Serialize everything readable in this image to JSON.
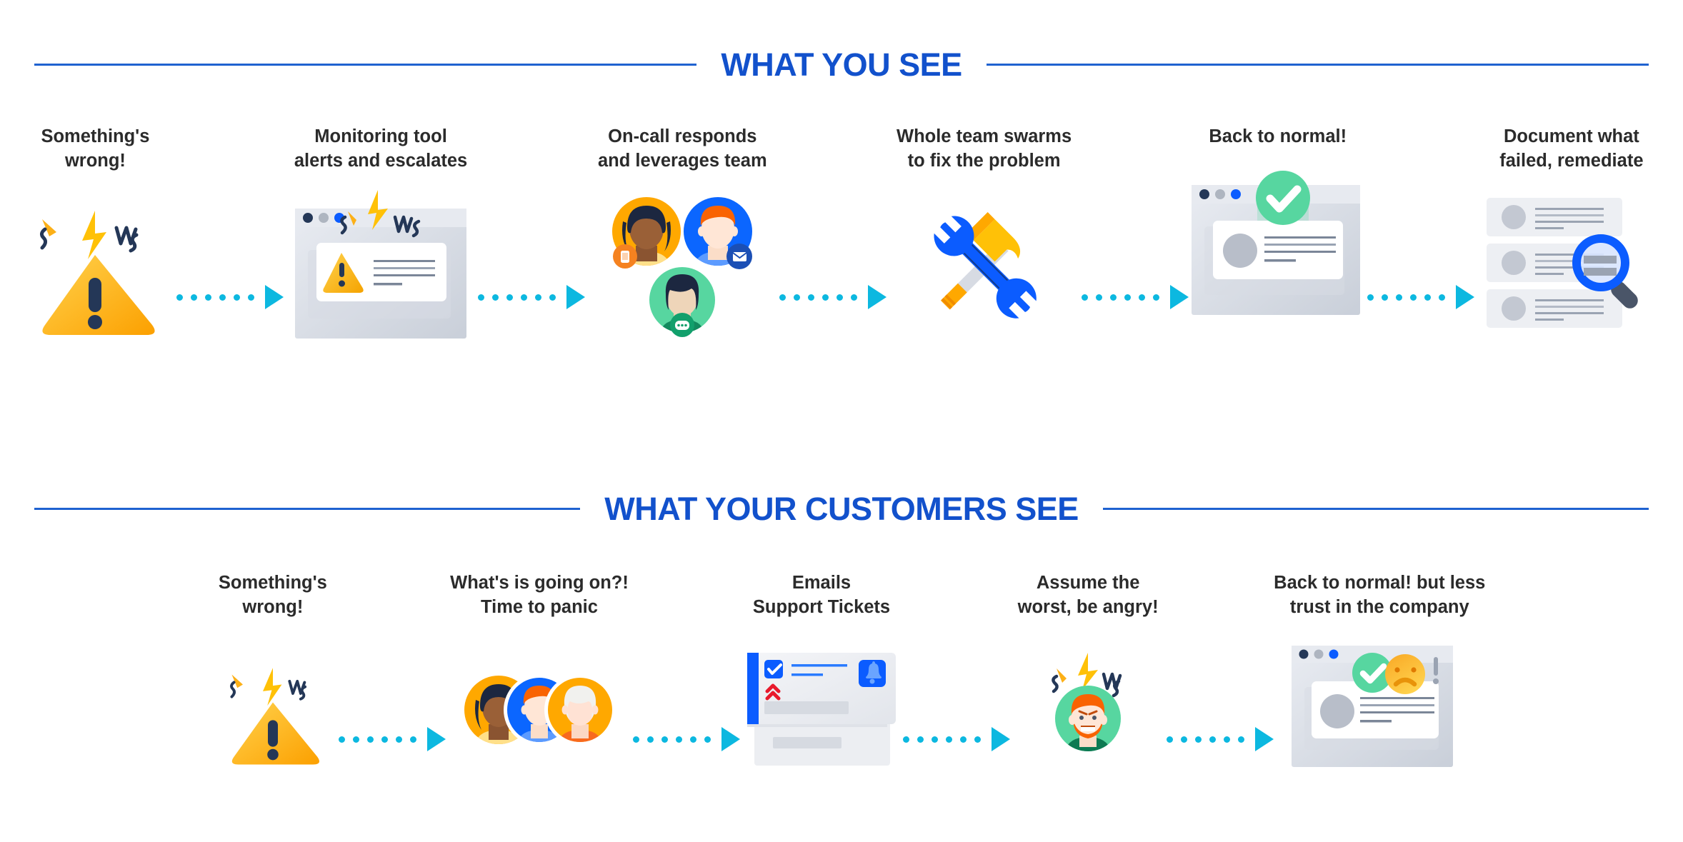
{
  "colors": {
    "heading_blue": "#1251cc",
    "rule_blue": "#1f62d0",
    "arrow_cyan": "#0cb8e0",
    "label_dark": "#2b2b2b",
    "warning_yellow": "#ffc107",
    "warning_amber": "#f9a825",
    "navy": "#243757",
    "tool_blue": "#0b5cff",
    "success_green": "#57d6a0",
    "avatar_orange": "#ffa800",
    "avatar_blue": "#0b66ff",
    "avatar_green": "#57d6a0",
    "urgent_red": "#e8192c",
    "sad_orange": "#f9a825"
  },
  "sections": [
    {
      "title": "WHAT YOU SEE",
      "steps": [
        {
          "label": "Something's\nwrong!",
          "icon": "warning-triangle-icon"
        },
        {
          "label": "Monitoring tool\nalerts and escalates",
          "icon": "browser-alert-window-icon"
        },
        {
          "label": "On-call responds\nand leverages team",
          "icon": "oncall-team-avatars-icon"
        },
        {
          "label": "Whole team swarms\nto fix the problem",
          "icon": "hammer-wrench-tools-icon"
        },
        {
          "label": "Back to normal!",
          "icon": "browser-success-check-icon"
        },
        {
          "label": "Document what\nfailed, remediate",
          "icon": "document-list-magnifier-icon"
        }
      ]
    },
    {
      "title": "WHAT YOUR CUSTOMERS SEE",
      "steps": [
        {
          "label": "Something's\nwrong!",
          "icon": "warning-triangle-icon"
        },
        {
          "label": "What's is going on?!\nTime to panic",
          "icon": "customer-avatars-group-icon"
        },
        {
          "label": "Emails\nSupport Tickets",
          "icon": "support-ticket-email-icon"
        },
        {
          "label": "Assume the\nworst, be angry!",
          "icon": "angry-customer-avatar-icon"
        },
        {
          "label": "Back to normal! but less\ntrust in the company",
          "icon": "browser-mixed-sentiment-icon"
        }
      ]
    }
  ],
  "arrow": {
    "dot_count": 6,
    "name": "dotted-arrow"
  },
  "badges": {
    "phone": "phone-badge-icon",
    "envelope": "envelope-badge-icon",
    "chat": "chat-bubble-badge-icon"
  },
  "ticket": {
    "checkbox": "checkbox-checked-icon",
    "priority": "double-chevron-up-icon",
    "bell": "bell-icon"
  },
  "sentiment": {
    "check": "check-circle-icon",
    "sad": "sad-face-icon",
    "exclaim": "exclamation-mark-icon"
  }
}
